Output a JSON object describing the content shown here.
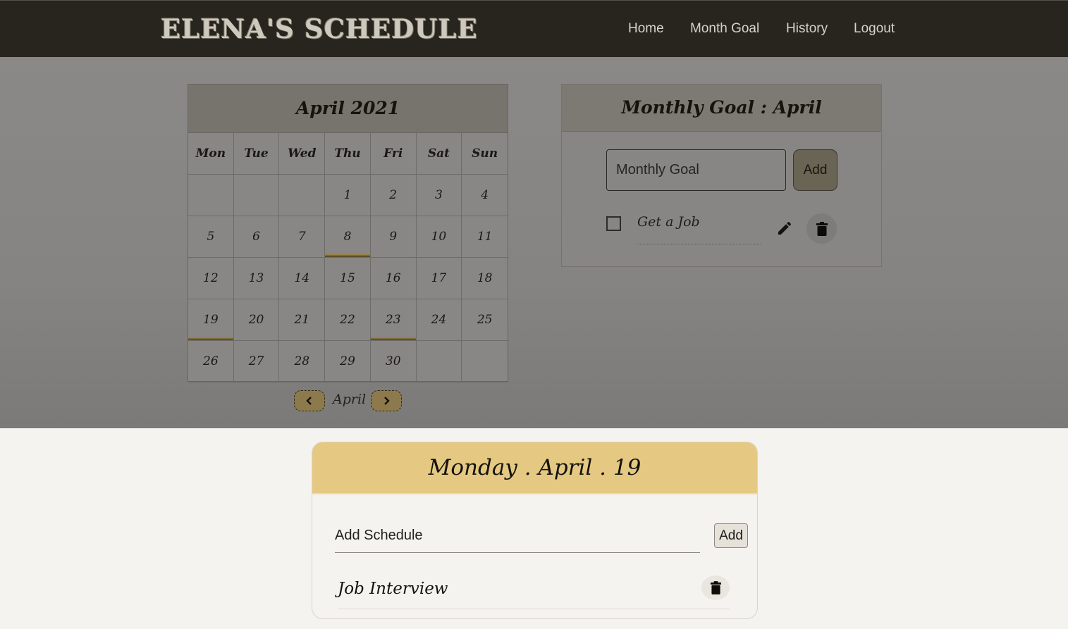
{
  "navbar": {
    "brand": "ELENA'S SCHEDULE",
    "links": [
      "Home",
      "Month Goal",
      "History",
      "Logout"
    ]
  },
  "calendar": {
    "title": "April 2021",
    "weekdays": [
      "Mon",
      "Tue",
      "Wed",
      "Thu",
      "Fri",
      "Sat",
      "Sun"
    ],
    "days": [
      "",
      "",
      "",
      "1",
      "2",
      "3",
      "4",
      "5",
      "6",
      "7",
      "8",
      "9",
      "10",
      "11",
      "12",
      "13",
      "14",
      "15",
      "16",
      "17",
      "18",
      "19",
      "20",
      "21",
      "22",
      "23",
      "24",
      "25",
      "26",
      "27",
      "28",
      "29",
      "30",
      "",
      ""
    ],
    "marked_days": [
      "8",
      "19",
      "23"
    ],
    "nav_month": "April",
    "colors": {
      "marker": "#a38a45"
    }
  },
  "goal": {
    "title": "Monthly Goal : April",
    "input_placeholder": "Monthly Goal",
    "add_label": "Add",
    "items": [
      {
        "text": "Get a Job",
        "checked": false
      }
    ]
  },
  "schedule": {
    "title": "Monday . April . 19",
    "input_placeholder": "Add Schedule",
    "add_label": "Add",
    "items": [
      "Job Interview"
    ],
    "colors": {
      "header": "#e5c983"
    }
  }
}
